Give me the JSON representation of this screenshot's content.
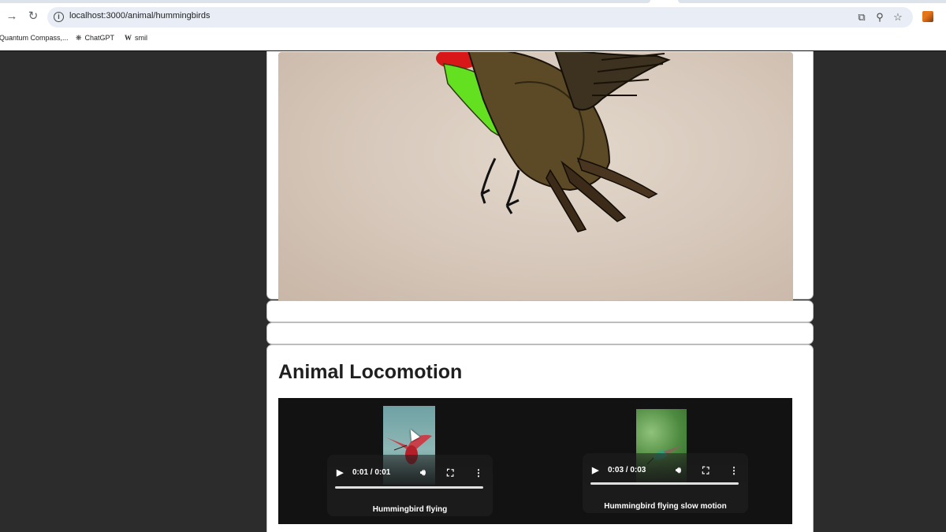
{
  "browser": {
    "url": "localhost:3000/animal/hummingbirds",
    "bookmarks": [
      {
        "label": "Quantum Compass,...",
        "icon": "folder-icon"
      },
      {
        "label": "ChatGPT",
        "icon": "chatgpt-icon"
      },
      {
        "label": "smil",
        "icon": "wikipedia-icon"
      }
    ]
  },
  "page": {
    "locomotion": {
      "title": "Animal Locomotion",
      "videos": [
        {
          "time": "0:01 / 0:01",
          "caption": "Hummingbird flying",
          "progress": 1.0
        },
        {
          "time": "0:03 / 0:03",
          "caption": "Hummingbird flying slow motion",
          "progress": 1.0
        }
      ]
    }
  },
  "colors": {
    "page_background": "#2c2c2c",
    "card_background": "#ffffff",
    "video_background": "#121212"
  }
}
